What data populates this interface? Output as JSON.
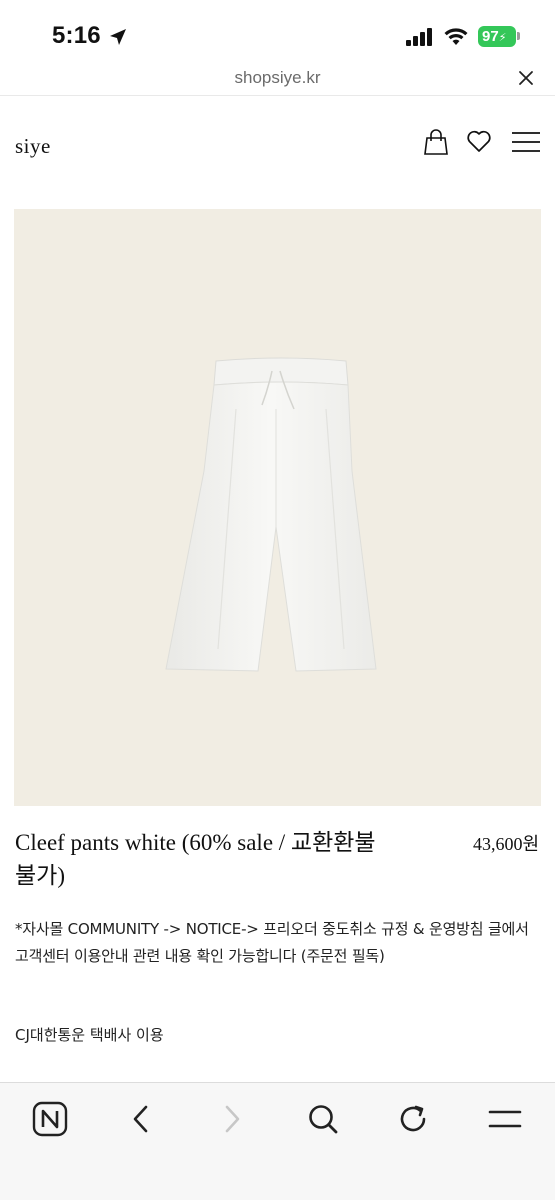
{
  "status_bar": {
    "time": "5:16",
    "battery": "97",
    "icons": [
      "location-arrow-icon",
      "cellular-signal-icon",
      "wifi-icon",
      "battery-icon"
    ]
  },
  "browser": {
    "url": "shopsiye.kr",
    "close_icon": "close-icon"
  },
  "header": {
    "logo": "siye",
    "icons": [
      "shopping-bag-icon",
      "heart-icon",
      "menu-icon"
    ]
  },
  "product": {
    "image": "white-pants-photo",
    "title": "Cleef pants white (60% sale / 교환환불불가)",
    "price": "43,600원",
    "notice": "*자사몰  COMMUNITY -> NOTICE->  프리오더 중도취소 규정 & 운영방침 글에서 고객센터 이용안내 관련 내용 확인 가능합니다 (주문전 필독)",
    "shipping": "CJ대한통운 택배사 이용"
  },
  "toolbar": {
    "buttons": [
      "naver-icon",
      "back-icon",
      "forward-icon",
      "search-icon",
      "reload-icon",
      "menu-icon"
    ]
  },
  "colors": {
    "image_bg": "#f1ede3",
    "battery_green": "#34c759"
  }
}
